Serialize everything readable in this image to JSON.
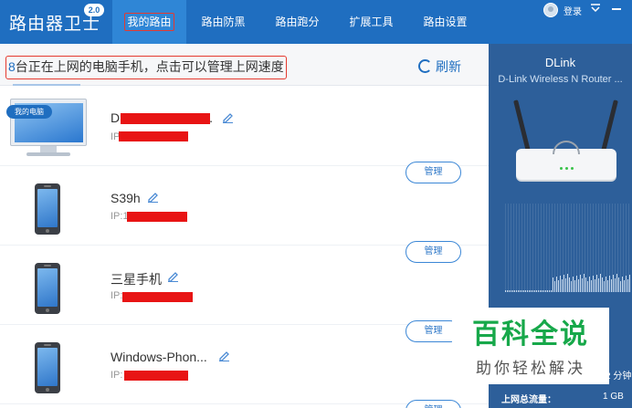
{
  "app": {
    "title": "路由器卫士",
    "version": "2.0"
  },
  "nav": {
    "tabs": [
      {
        "label": "我的路由",
        "active": true
      },
      {
        "label": "路由防黑",
        "active": false
      },
      {
        "label": "路由跑分",
        "active": false
      },
      {
        "label": "扩展工具",
        "active": false
      },
      {
        "label": "路由设置",
        "active": false
      }
    ],
    "login": "登录",
    "icons": [
      "avatar-icon",
      "menu-icon",
      "minimize-icon"
    ]
  },
  "devices_panel": {
    "count": "8",
    "info_text": "台正在上网的电脑手机，点击可以管理上网速度",
    "refresh_label": "刷新",
    "devices": [
      {
        "name": "D",
        "name_suffix": ".",
        "ip": "IP",
        "type": "pc",
        "badge": "我的电脑",
        "manage_label": "管理"
      },
      {
        "name": "S39h",
        "ip": "IP:1",
        "type": "phone",
        "manage_label": "管理"
      },
      {
        "name": "三星手机",
        "ip": "IP:",
        "type": "phone",
        "manage_label": "管理"
      },
      {
        "name": "Windows-Phon...",
        "ip": "IP:",
        "type": "phone",
        "manage_label": "管理"
      }
    ]
  },
  "router": {
    "name": "DLink",
    "model": "D-Link Wireless N Router ..."
  },
  "stats": {
    "partial_value": "2 分钟",
    "total_traffic_label": "上网总流量：",
    "total_traffic_value": "1 GB"
  },
  "watermark": {
    "title": "百科全说",
    "subtitle": "助你轻松解决"
  },
  "colors": {
    "accent": "#1f6ec0",
    "redaction": "#e81414",
    "annotation": "#e53a2f",
    "watermark_green": "#17a84a"
  }
}
